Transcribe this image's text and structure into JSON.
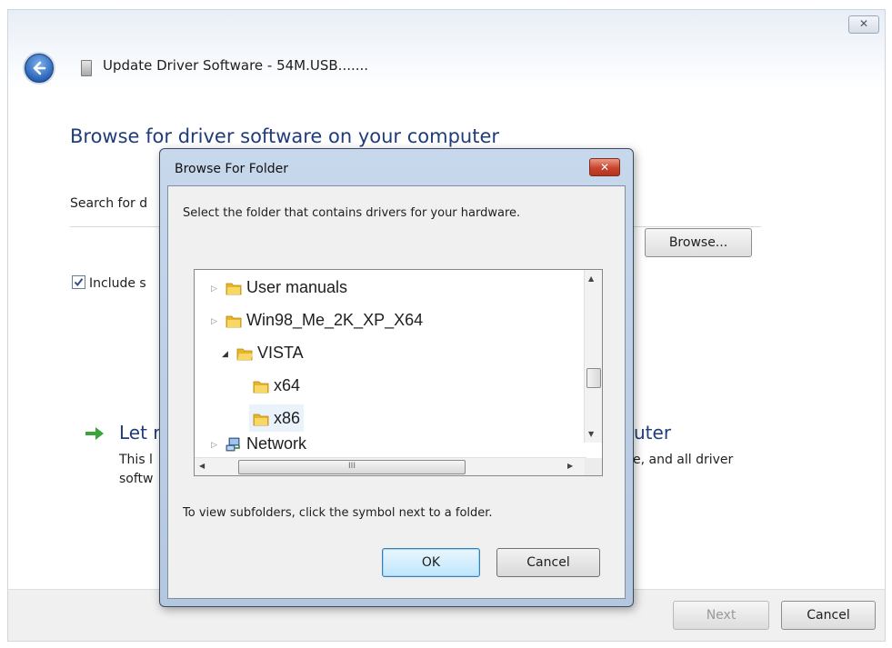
{
  "wizard": {
    "title": "Update Driver Software - 54M.USB.......",
    "close_label": "✕",
    "heading": "Browse for driver software on your computer",
    "search_label_visible": "Search for d",
    "browse_label": "Browse...",
    "include_label_visible": "Include s",
    "include_checked": true,
    "let_title_left": "Let r",
    "let_title_right": "uter",
    "let_desc_line1_left": "This l",
    "let_desc_line1_right": "e, and all driver",
    "let_desc_line2_left": "softw",
    "next_label": "Next",
    "cancel_label": "Cancel"
  },
  "dialog": {
    "title": "Browse For Folder",
    "close_label": "✕",
    "prompt": "Select the folder that contains drivers for your hardware.",
    "tree": [
      {
        "label": "User manuals",
        "level": 0,
        "expanded": false,
        "icon": "folder-icon"
      },
      {
        "label": "Win98_Me_2K_XP_X64",
        "level": 0,
        "expanded": false,
        "icon": "folder-icon"
      },
      {
        "label": "VISTA",
        "level": 0,
        "expanded": true,
        "icon": "folder-icon"
      },
      {
        "label": "x64",
        "level": 1,
        "icon": "folder-icon"
      },
      {
        "label": "x86",
        "level": 1,
        "icon": "folder-icon",
        "hover": true
      },
      {
        "label": "Network",
        "level": 0,
        "expanded": false,
        "icon": "network-icon"
      }
    ],
    "hscroll_thumb_glyph": "III",
    "hint": "To view subfolders, click the symbol next to a folder.",
    "ok_label": "OK",
    "cancel_label": "Cancel"
  },
  "colors": {
    "heading_blue": "#1f3d7a",
    "dialog_frame": "#b3c7df",
    "close_red": "#c9432d",
    "folder_yellow": "#e8b52a"
  }
}
